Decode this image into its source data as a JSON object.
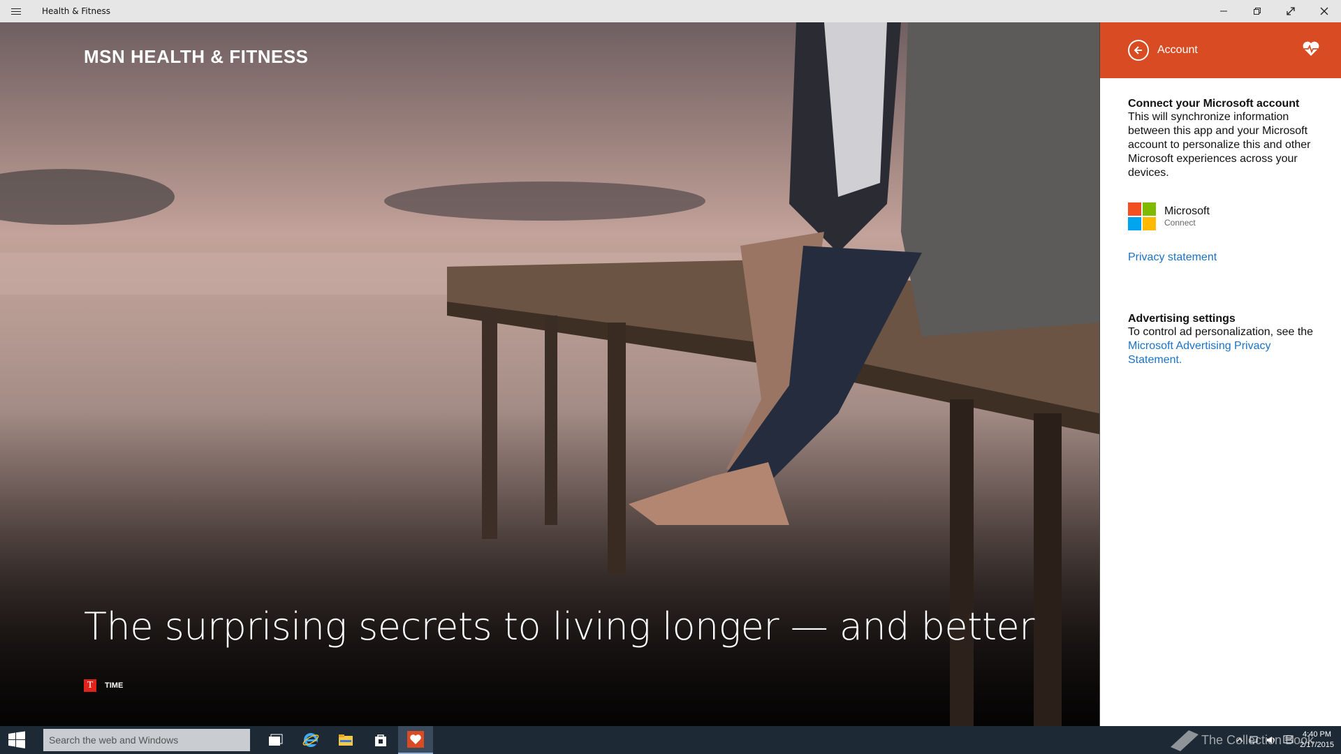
{
  "window": {
    "title": "Health & Fitness"
  },
  "hero": {
    "brand": "MSN HEALTH & FITNESS",
    "headline": "The surprising secrets to living longer — and better",
    "source_logo_letter": "T",
    "source_name": "TIME"
  },
  "account_pane": {
    "title": "Account",
    "connect_heading": "Connect your Microsoft account",
    "connect_text": "This will synchronize information between this app and your Microsoft account to personalize this and other Microsoft experiences across your devices.",
    "microsoft_name": "Microsoft",
    "microsoft_action": "Connect",
    "privacy_link": "Privacy statement",
    "advertising_heading": "Advertising settings",
    "advertising_text": "To control ad personalization, see the",
    "advertising_link": "Microsoft Advertising Privacy Statement.",
    "accent_color": "#d84b23",
    "link_color": "#1a73c9"
  },
  "taskbar": {
    "search_placeholder": "Search the web and Windows",
    "time": "4:40 PM",
    "date": "2/17/2015",
    "watermark": "The Collection Book"
  }
}
